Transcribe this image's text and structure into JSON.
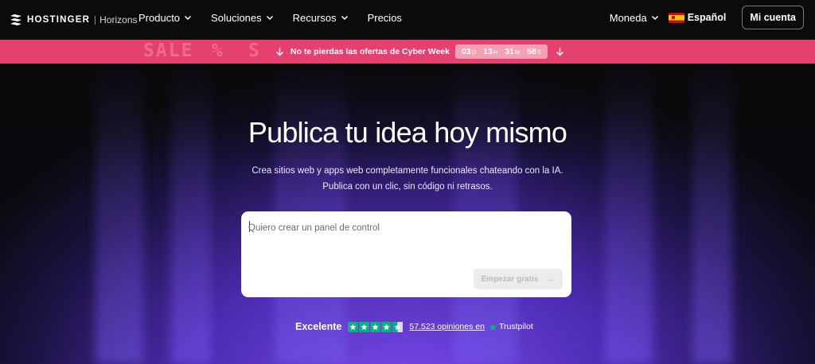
{
  "brand": {
    "name": "HOSTINGER",
    "product": "Horizons"
  },
  "nav": {
    "items": [
      {
        "label": "Producto",
        "has_dropdown": true
      },
      {
        "label": "Soluciones",
        "has_dropdown": true
      },
      {
        "label": "Recursos",
        "has_dropdown": true
      },
      {
        "label": "Precios",
        "has_dropdown": false
      }
    ],
    "currency_label": "Moneda",
    "language_label": "Español",
    "account_label": "Mi cuenta"
  },
  "promo": {
    "ghost_text": [
      "SALE",
      "%",
      "S"
    ],
    "text": "No te pierdas las ofertas de Cyber Week",
    "countdown": [
      {
        "value": "03",
        "unit": "D"
      },
      {
        "value": "13",
        "unit": "H"
      },
      {
        "value": "31",
        "unit": "M"
      },
      {
        "value": "58",
        "unit": "S"
      }
    ],
    "color": "#e4416e"
  },
  "hero": {
    "title": "Publica tu idea hoy mismo",
    "subtitle_line1": "Crea sitios web y apps web completamente funcionales chateando con la IA.",
    "subtitle_line2": "Publica con un clic, sin código ni retrasos.",
    "prompt_placeholder": "Quiero crear un panel de control",
    "start_button": "Empezar gratis",
    "start_button_arrow": "→"
  },
  "rating": {
    "label": "Excelente",
    "stars": 4.5,
    "reviews_text": "57.523 opiniones en",
    "provider": "Trustpilot",
    "star_color": "#00b67a"
  }
}
